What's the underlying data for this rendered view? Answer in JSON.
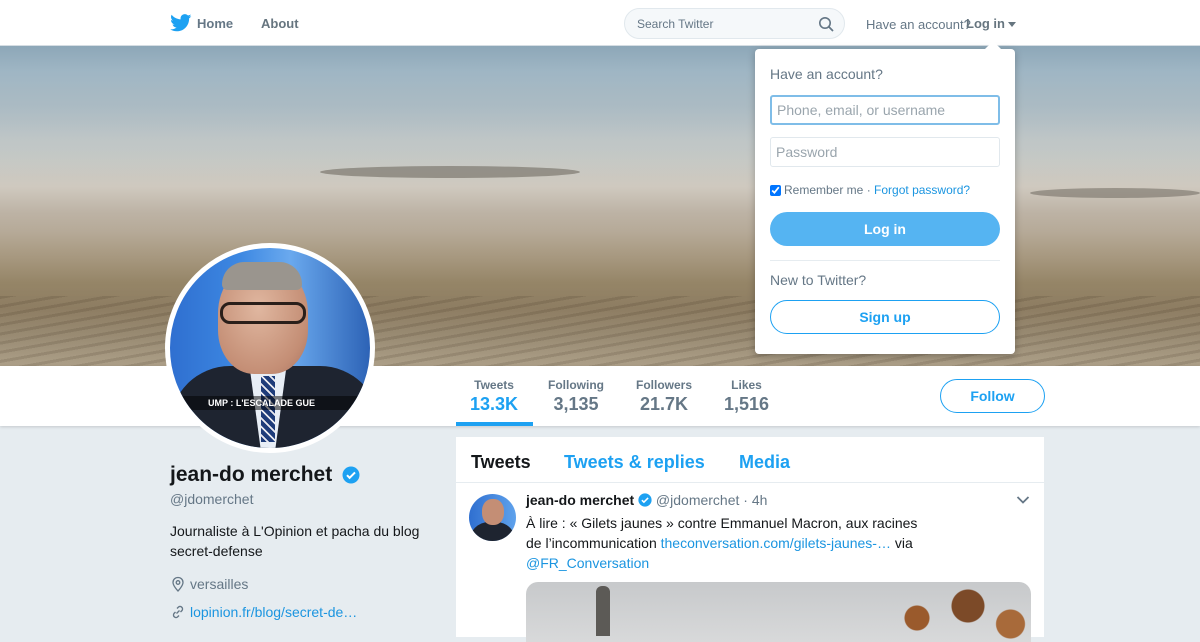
{
  "nav": {
    "home": "Home",
    "about": "About"
  },
  "search": {
    "placeholder": "Search Twitter"
  },
  "account": {
    "prompt": "Have an account?",
    "login_toggle": "Log in"
  },
  "stats": [
    {
      "label": "Tweets",
      "value": "13.3K"
    },
    {
      "label": "Following",
      "value": "3,135"
    },
    {
      "label": "Followers",
      "value": "21.7K"
    },
    {
      "label": "Likes",
      "value": "1,516"
    }
  ],
  "follow_label": "Follow",
  "profile": {
    "name": "jean-do merchet",
    "handle": "@jdomerchet",
    "bio": "Journaliste à L'Opinion et pacha du blog secret-defense",
    "location": "versailles",
    "website": "lopinion.fr/blog/secret-de…",
    "avatar_caption": "UMP : L'ESCALADE GUE"
  },
  "tabs": [
    "Tweets",
    "Tweets & replies",
    "Media"
  ],
  "tweet": {
    "name": "jean-do merchet",
    "handle": "@jdomerchet",
    "time": "4h",
    "text_before": "À lire : « Gilets jaunes » contre Emmanuel Macron, aux racines de l’incommunication",
    "link": "theconversation.com/gilets-jaunes-…",
    "via": "via",
    "mention": "@FR_Conversation"
  },
  "login": {
    "title": "Have an account?",
    "username_placeholder": "Phone, email, or username",
    "password_placeholder": "Password",
    "remember": "Remember me",
    "separator": "·",
    "forgot": "Forgot password?",
    "login_button": "Log in",
    "new_prompt": "New to Twitter?",
    "signup_button": "Sign up"
  },
  "colors": {
    "accent": "#1da1f2",
    "link": "#1b95e0",
    "background": "#e6ecf0"
  }
}
